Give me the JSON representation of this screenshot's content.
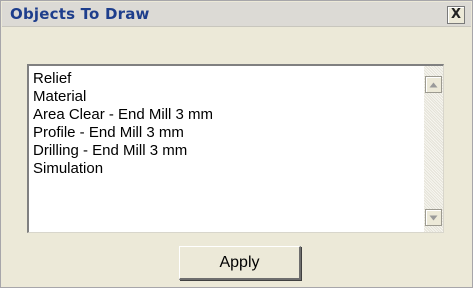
{
  "window": {
    "title": "Objects To Draw",
    "close_label": "X"
  },
  "objects": [
    "Relief",
    "Material",
    "Area Clear - End Mill 3 mm",
    "Profile - End Mill 3 mm",
    "Drilling - End Mill 3 mm",
    "Simulation"
  ],
  "buttons": {
    "apply_label": "Apply"
  },
  "colors": {
    "title_text": "#1e3e8c",
    "dialog_bg": "#ece9d8"
  },
  "icons": {
    "close": "close-icon",
    "scroll_up": "arrow-up-icon",
    "scroll_down": "arrow-down-icon"
  }
}
